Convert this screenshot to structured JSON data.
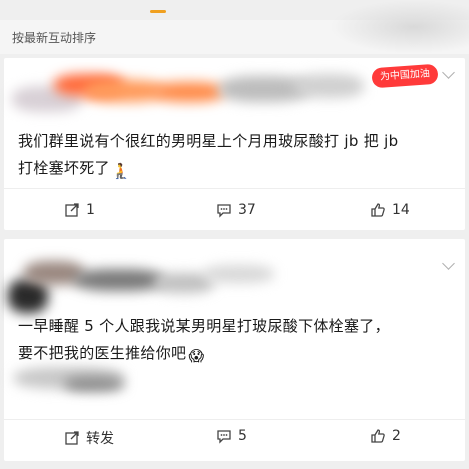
{
  "sort_bar": {
    "label": "按最新互动排序"
  },
  "comments": [
    {
      "badge": "为中国加油",
      "text_line1": "我们群里说有个很红的男明星上个月用玻尿酸打 jb 把 jb",
      "text_line2": "打栓塞坏死了",
      "emoji": "🧎",
      "actions": {
        "share": "1",
        "comment": "37",
        "like": "14"
      }
    },
    {
      "text_line1": "一早睡醒 5 个人跟我说某男明星打玻尿酸下体栓塞了，",
      "text_line2": "要不把我的医生推给你吧",
      "emoji": "😱",
      "actions": {
        "share": "转发",
        "comment": "5",
        "like": "2"
      }
    }
  ],
  "icons": {
    "share": "share-icon",
    "comment": "comment-icon",
    "like": "thumbs-up-icon",
    "expand": "chevron-down-icon"
  },
  "colors": {
    "accent_handle": "#f0a020",
    "badge": "#ff3a3a"
  }
}
